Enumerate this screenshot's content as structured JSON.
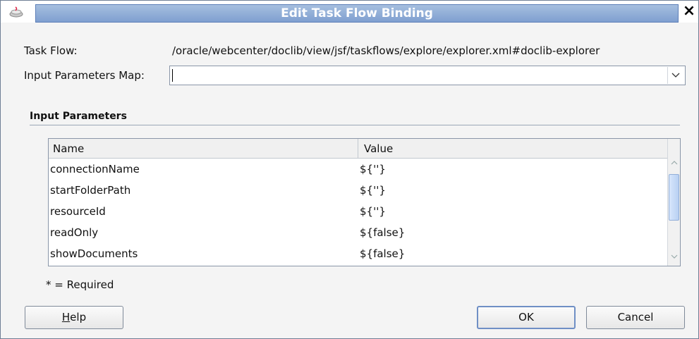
{
  "window": {
    "title": "Edit Task Flow Binding",
    "close_glyph": "×"
  },
  "form": {
    "task_flow_label": "Task Flow:",
    "task_flow_value": "/oracle/webcenter/doclib/view/jsf/taskflows/explore/explorer.xml#doclib-explorer",
    "input_map_label": "Input Parameters Map:",
    "input_map_value": ""
  },
  "section": {
    "title": "Input Parameters"
  },
  "table": {
    "columns": [
      "Name",
      "Value"
    ],
    "rows": [
      {
        "name": "connectionName",
        "value": "${''}"
      },
      {
        "name": "startFolderPath",
        "value": "${''}"
      },
      {
        "name": "resourceId",
        "value": "${''}"
      },
      {
        "name": "readOnly",
        "value": "${false}"
      },
      {
        "name": "showDocuments",
        "value": "${false}"
      }
    ]
  },
  "footer": {
    "required_note": "* = Required",
    "help_label_mnemonic": "H",
    "help_label_rest": "elp",
    "ok_label": "OK",
    "cancel_label": "Cancel"
  },
  "colors": {
    "title_bar": "#7f9fd0",
    "dialog_bg": "#f4f4f4",
    "scroll_thumb": "#b8d0f3"
  }
}
